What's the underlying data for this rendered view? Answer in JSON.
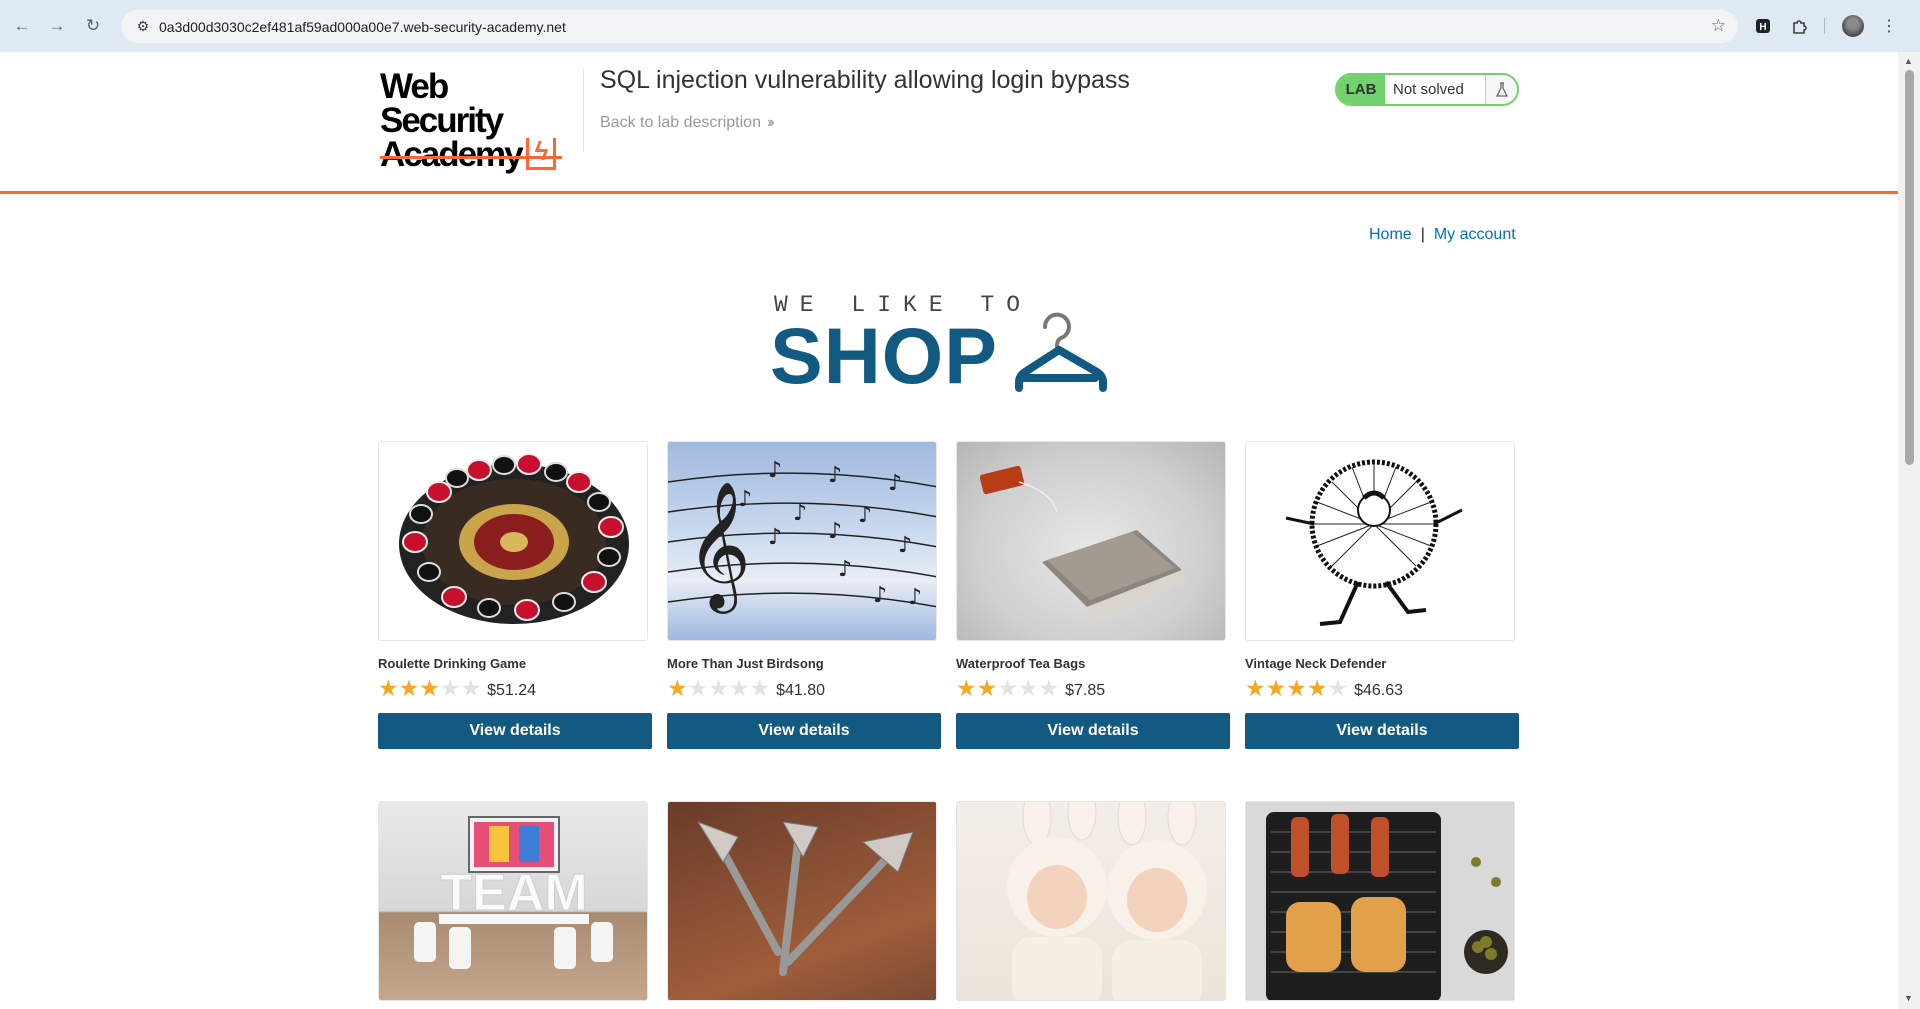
{
  "browser": {
    "url": "0a3d00d3030c2ef481af59ad000a00e7.web-security-academy.net"
  },
  "lab_header": {
    "logo_line1": "Web Security",
    "logo_line2": "Academy",
    "title": "SQL injection vulnerability allowing login bypass",
    "back_link": "Back to lab description",
    "status_badge": "LAB",
    "status_text": "Not solved"
  },
  "nav": {
    "home": "Home",
    "separator": "|",
    "my_account": "My account"
  },
  "banner": {
    "line1": "WE LIKE TO",
    "line2": "SHOP"
  },
  "colors": {
    "accent_orange": "#ff6633",
    "brand_blue": "#135a83",
    "status_green": "#70d16d",
    "star_gold": "#f7a823",
    "link_blue": "#0071bc"
  },
  "products": [
    {
      "name": "Roulette Drinking Game",
      "rating": 3,
      "price": "$51.24",
      "button": "View details",
      "image": "roulette"
    },
    {
      "name": "More Than Just Birdsong",
      "rating": 1,
      "price": "$41.80",
      "button": "View details",
      "image": "birdsong"
    },
    {
      "name": "Waterproof Tea Bags",
      "rating": 2,
      "price": "$7.85",
      "button": "View details",
      "image": "teabag"
    },
    {
      "name": "Vintage Neck Defender",
      "rating": 4,
      "price": "$46.63",
      "button": "View details",
      "image": "neck"
    },
    {
      "name": "",
      "rating": 0,
      "price": "",
      "button": "",
      "image": "team",
      "image_text": "TEAM"
    },
    {
      "name": "",
      "rating": 0,
      "price": "",
      "button": "",
      "image": "darts"
    },
    {
      "name": "",
      "rating": 0,
      "price": "",
      "button": "",
      "image": "babies"
    },
    {
      "name": "",
      "rating": 0,
      "price": "",
      "button": "",
      "image": "grill"
    }
  ]
}
